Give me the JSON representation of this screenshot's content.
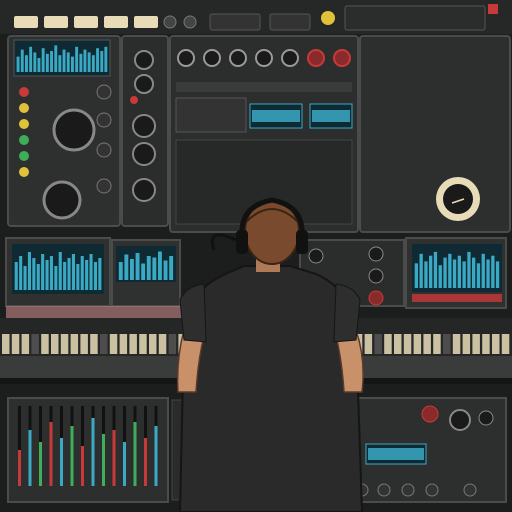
{
  "scene": {
    "kind": "illustration",
    "subject": "person-at-synth-console",
    "colors": {
      "background": "#1e1f1f",
      "panel": "#2f3030",
      "panel_dark": "#232424",
      "bezel": "#4a4b4b",
      "screen": "#0f2a33",
      "wave": "#3aa9c4",
      "cream": "#e8dcb8",
      "red": "#c83a3a",
      "yellow": "#e0c23a",
      "green": "#3fae5a",
      "shirt": "#2a2a2a",
      "hair": "#7a4a2e",
      "skin": "#c9916a"
    },
    "top_screen_wave": [
      0.55,
      0.8,
      0.6,
      0.9,
      0.7,
      0.5,
      0.85,
      0.65,
      0.75,
      0.95,
      0.6,
      0.8,
      0.7,
      0.55,
      0.9,
      0.65,
      0.8,
      0.7,
      0.6,
      0.85,
      0.75,
      0.9
    ],
    "left_screen_wave": [
      0.7,
      0.85,
      0.6,
      0.95,
      0.8,
      0.65,
      0.9,
      0.75,
      0.85,
      0.6,
      0.95,
      0.7,
      0.8,
      0.9,
      0.65,
      0.85,
      0.75,
      0.9,
      0.7,
      0.8
    ],
    "mid_screen_wave": [
      0.6,
      0.85,
      0.7,
      0.9,
      0.55,
      0.8,
      0.75,
      0.95,
      0.65,
      0.8
    ],
    "right_screen_wave": [
      0.65,
      0.9,
      0.7,
      0.85,
      0.95,
      0.6,
      0.8,
      0.9,
      0.75,
      0.85,
      0.7,
      0.95,
      0.8,
      0.65,
      0.9,
      0.75,
      0.85,
      0.7
    ],
    "faders": [
      0.45,
      0.7,
      0.55,
      0.8,
      0.6,
      0.75,
      0.5,
      0.85,
      0.65,
      0.7,
      0.55,
      0.8,
      0.6,
      0.75
    ]
  }
}
